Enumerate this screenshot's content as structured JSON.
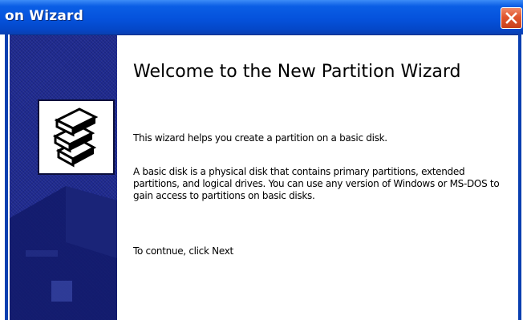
{
  "window": {
    "title": "on Wizard"
  },
  "content": {
    "heading": "Welcome to the New Partition Wizard",
    "intro": "This wizard helps you create a partition on a basic disk.",
    "description": "A basic disk is a physical disk that contains primary partitions, extended partitions, and logical drives. You can use any version of Windows or MS-DOS to gain access to partitions on basic disks.",
    "continue": "To contnue, click Next"
  },
  "icons": {
    "close": "close-icon",
    "wizard": "disk-stack-icon",
    "banner_art": "computer-silhouette"
  },
  "colors": {
    "titlebar": "#0552dc",
    "banner": "#1f2a8f",
    "close": "#e0552e",
    "text": "#000000"
  }
}
